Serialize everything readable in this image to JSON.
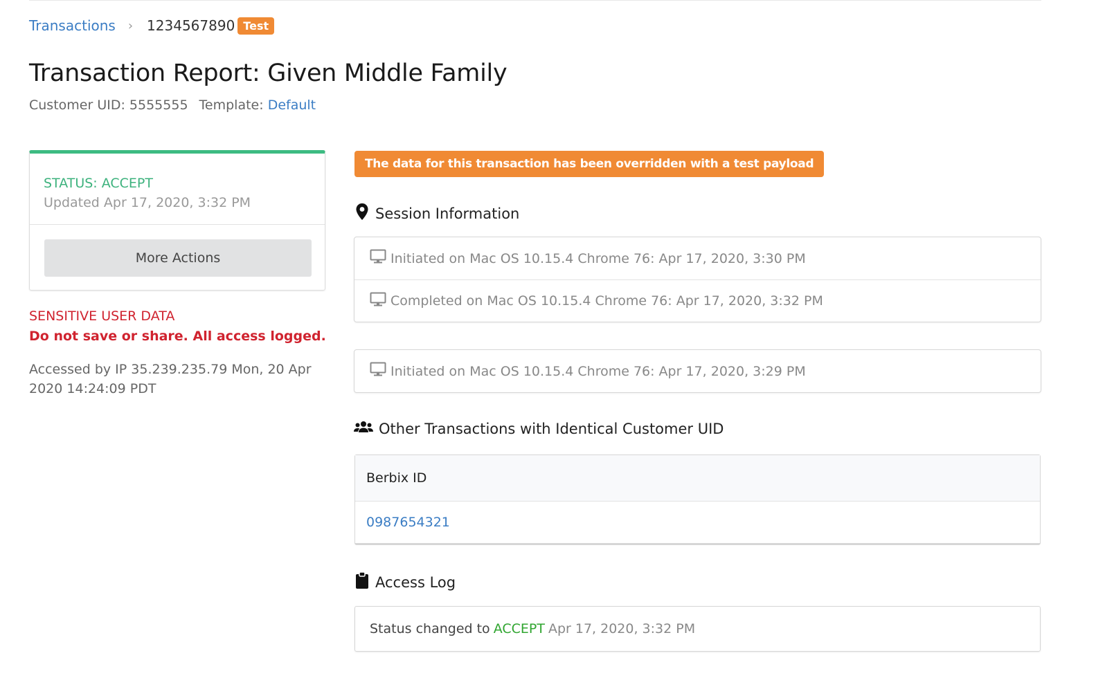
{
  "breadcrumb": {
    "root": "Transactions",
    "separator": "›",
    "current": "1234567890",
    "badge": "Test"
  },
  "header": {
    "title": "Transaction Report: Given Middle Family",
    "customer_uid_label": "Customer UID: 5555555",
    "template_label": "Template:",
    "template_value": "Default"
  },
  "status_card": {
    "status": "STATUS: ACCEPT",
    "updated": "Updated Apr 17, 2020, 3:32 PM",
    "more_actions": "More Actions",
    "accent_color": "#3dbb82"
  },
  "sensitive": {
    "line1": "SENSITIVE USER DATA",
    "line2": "Do not save or share. All access logged."
  },
  "accessed": "Accessed by IP 35.239.235.79 Mon, 20 Apr 2020 14:24:09 PDT",
  "override_banner": "The data for this transaction has been overridden with a test payload",
  "session": {
    "heading": "Session Information",
    "heading_icon": "map-marker-icon",
    "row_icon": "desktop-icon",
    "group1": [
      "Initiated on Mac OS 10.15.4 Chrome 76: Apr 17, 2020, 3:30 PM",
      "Completed on Mac OS 10.15.4 Chrome 76: Apr 17, 2020, 3:32 PM"
    ],
    "group2": [
      "Initiated on Mac OS 10.15.4 Chrome 76: Apr 17, 2020, 3:29 PM"
    ]
  },
  "other_transactions": {
    "heading": "Other Transactions with Identical Customer UID",
    "heading_icon": "users-icon",
    "column": "Berbix ID",
    "rows": [
      "0987654321"
    ]
  },
  "access_log": {
    "heading": "Access Log",
    "heading_icon": "clipboard-icon",
    "prefix": "Status changed to",
    "status": "ACCEPT",
    "date": "Apr 17, 2020, 3:32 PM"
  },
  "colors": {
    "link": "#3b7dc4",
    "accept_green": "#3db27d",
    "warning_orange": "#f08a34",
    "danger_red": "#d0232f"
  }
}
